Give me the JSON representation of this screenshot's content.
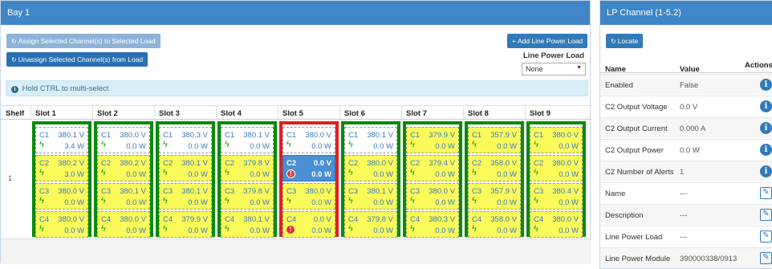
{
  "bay": {
    "title": "Bay 1",
    "assign_label": "Assign Selected Channel(s) to Selected Load",
    "unassign_label": "Unassign Selected Channel(s) from Load",
    "add_load_label": "+ Add Line Power Load",
    "line_power_load_label": "Line Power Load",
    "line_power_load_value": "None",
    "hint": "Hold CTRL to multi-select",
    "columns": [
      "Shelf",
      "Slot 1",
      "Slot 2",
      "Slot 3",
      "Slot 4",
      "Slot 5",
      "Slot 6",
      "Slot 7",
      "Slot 8",
      "Slot 9"
    ],
    "shelf": "1",
    "slots": [
      {
        "alert": false,
        "channels": [
          {
            "name": "C1",
            "voltage": "380.1 V",
            "power": "3.4 W",
            "style": "white",
            "icon": "bolt"
          },
          {
            "name": "C2",
            "voltage": "380.2 V",
            "power": "3.0 W",
            "style": "yellow",
            "icon": "bolt"
          },
          {
            "name": "C3",
            "voltage": "380.0 V",
            "power": "0.0 W",
            "style": "yellow",
            "icon": "bolt"
          },
          {
            "name": "C4",
            "voltage": "380.0 V",
            "power": "0.0 W",
            "style": "yellow",
            "icon": "bolt"
          }
        ]
      },
      {
        "alert": false,
        "channels": [
          {
            "name": "C1",
            "voltage": "380.0 V",
            "power": "0.0 W",
            "style": "white",
            "icon": "bolt"
          },
          {
            "name": "C2",
            "voltage": "380.2 V",
            "power": "0.0 W",
            "style": "yellow",
            "icon": "bolt"
          },
          {
            "name": "C3",
            "voltage": "380.1 V",
            "power": "0.0 W",
            "style": "yellow",
            "icon": "bolt"
          },
          {
            "name": "C4",
            "voltage": "380.0 V",
            "power": "0.0 W",
            "style": "yellow",
            "icon": "bolt"
          }
        ]
      },
      {
        "alert": false,
        "channels": [
          {
            "name": "C1",
            "voltage": "380.3 V",
            "power": "0.0 W",
            "style": "white",
            "icon": "bolt"
          },
          {
            "name": "C2",
            "voltage": "380.1 V",
            "power": "0.0 W",
            "style": "yellow",
            "icon": "bolt"
          },
          {
            "name": "C3",
            "voltage": "380.1 V",
            "power": "0.0 W",
            "style": "yellow",
            "icon": "bolt"
          },
          {
            "name": "C4",
            "voltage": "379.9 V",
            "power": "0.0 W",
            "style": "yellow",
            "icon": "bolt"
          }
        ]
      },
      {
        "alert": false,
        "channels": [
          {
            "name": "C1",
            "voltage": "380.1 V",
            "power": "0.0 W",
            "style": "white",
            "icon": "bolt"
          },
          {
            "name": "C2",
            "voltage": "379.8 V",
            "power": "0.0 W",
            "style": "yellow",
            "icon": "bolt"
          },
          {
            "name": "C3",
            "voltage": "379.8 V",
            "power": "0.0 W",
            "style": "yellow",
            "icon": "bolt"
          },
          {
            "name": "C4",
            "voltage": "380.1 V",
            "power": "0.0 W",
            "style": "yellow",
            "icon": "bolt"
          }
        ]
      },
      {
        "alert": true,
        "channels": [
          {
            "name": "C1",
            "voltage": "380.0 V",
            "power": "0.0 W",
            "style": "white",
            "icon": "bolt"
          },
          {
            "name": "C2",
            "voltage": "0.0 V",
            "power": "0.0 W",
            "style": "selected",
            "icon": "alert"
          },
          {
            "name": "C3",
            "voltage": "380.0 V",
            "power": "0.0 W",
            "style": "yellow",
            "icon": "bolt"
          },
          {
            "name": "C4",
            "voltage": "0.0 V",
            "power": "0.0 W",
            "style": "yellow",
            "icon": "alert"
          }
        ]
      },
      {
        "alert": false,
        "channels": [
          {
            "name": "C1",
            "voltage": "380.1 V",
            "power": "0.0 W",
            "style": "white",
            "icon": "bolt"
          },
          {
            "name": "C2",
            "voltage": "380.0 V",
            "power": "0.0 W",
            "style": "yellow",
            "icon": "bolt"
          },
          {
            "name": "C3",
            "voltage": "380.1 V",
            "power": "0.0 W",
            "style": "yellow",
            "icon": "bolt"
          },
          {
            "name": "C4",
            "voltage": "379.8 V",
            "power": "0.0 W",
            "style": "yellow",
            "icon": "bolt"
          }
        ]
      },
      {
        "alert": false,
        "channels": [
          {
            "name": "C1",
            "voltage": "379.9 V",
            "power": "0.0 W",
            "style": "yellow",
            "icon": "bolt"
          },
          {
            "name": "C2",
            "voltage": "379.4 V",
            "power": "0.0 W",
            "style": "yellow",
            "icon": "bolt"
          },
          {
            "name": "C3",
            "voltage": "380.0 V",
            "power": "0.0 W",
            "style": "yellow",
            "icon": "bolt"
          },
          {
            "name": "C4",
            "voltage": "380.3 V",
            "power": "0.0 W",
            "style": "yellow",
            "icon": "bolt"
          }
        ]
      },
      {
        "alert": false,
        "channels": [
          {
            "name": "C1",
            "voltage": "357.9 V",
            "power": "0.0 W",
            "style": "yellow",
            "icon": "bolt"
          },
          {
            "name": "C2",
            "voltage": "358.0 V",
            "power": "0.0 W",
            "style": "yellow",
            "icon": "bolt"
          },
          {
            "name": "C3",
            "voltage": "357.9 V",
            "power": "0.0 W",
            "style": "yellow",
            "icon": "bolt"
          },
          {
            "name": "C4",
            "voltage": "358.0 V",
            "power": "0.0 W",
            "style": "yellow",
            "icon": "bolt"
          }
        ]
      },
      {
        "alert": false,
        "channels": [
          {
            "name": "C1",
            "voltage": "380.0 V",
            "power": "0.0 W",
            "style": "yellow",
            "icon": "bolt"
          },
          {
            "name": "C2",
            "voltage": "380.0 V",
            "power": "0.0 W",
            "style": "yellow",
            "icon": "bolt"
          },
          {
            "name": "C3",
            "voltage": "380.4 V",
            "power": "0.0 W",
            "style": "yellow",
            "icon": "bolt"
          },
          {
            "name": "C4",
            "voltage": "380.0 V",
            "power": "0.0 W",
            "style": "yellow",
            "icon": "bolt"
          }
        ]
      }
    ]
  },
  "lp_channel": {
    "title": "LP Channel (1-5.2)",
    "locate_label": "Locate",
    "col_name": "Name",
    "col_value": "Value",
    "col_actions": "Actions",
    "rows": [
      {
        "name": "Enabled",
        "value": "False",
        "action": "info-icon"
      },
      {
        "name": "C2 Output Voltage",
        "value": "0.0 V",
        "action": "info-icon"
      },
      {
        "name": "C2 Output Current",
        "value": "0.000 A",
        "action": "info-icon"
      },
      {
        "name": "C2 Output Power",
        "value": "0.0 W",
        "action": "info-icon"
      },
      {
        "name": "C2 Number of Alerts",
        "value": "1",
        "action": "info-icon"
      },
      {
        "name": "Name",
        "value": "---",
        "action": "edit-icon"
      },
      {
        "name": "Description",
        "value": "---",
        "action": "edit-icon"
      },
      {
        "name": "Line Power Load",
        "value": "---",
        "action": "edit-icon"
      },
      {
        "name": "Line Power Module",
        "value": "390000338/0913",
        "action": "edit-icon"
      }
    ]
  },
  "colors": {
    "header_blue": "#3e86c7",
    "slot_green": "#0a8a0a",
    "slot_alert_red": "#e02020",
    "channel_yellow": "#fafa5a",
    "channel_selected": "#4a90d2"
  }
}
